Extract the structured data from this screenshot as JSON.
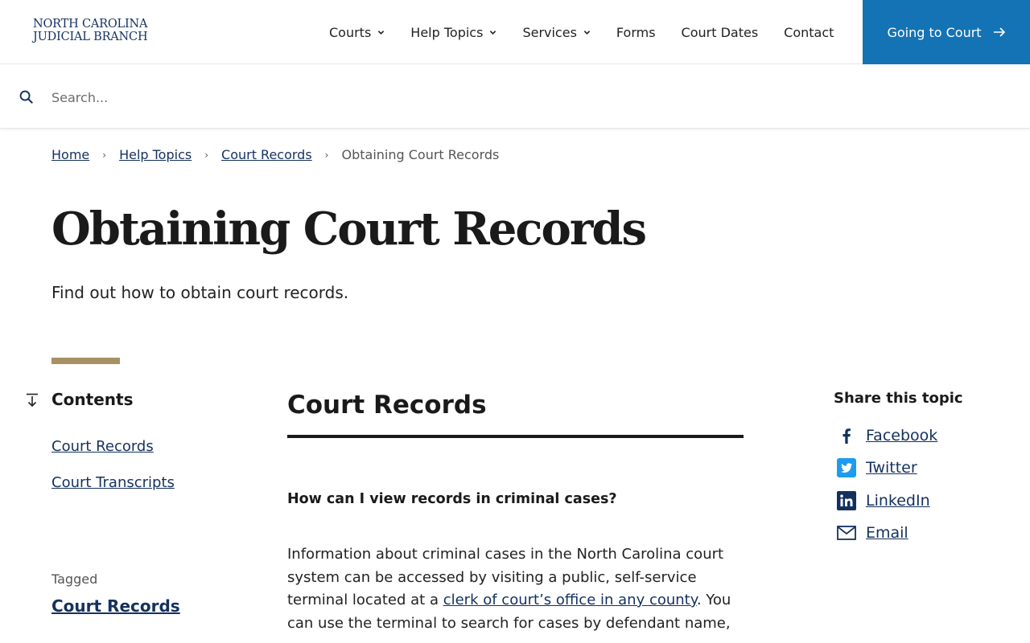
{
  "brand": {
    "line1": "NORTH CAROLINA",
    "line2": "JUDICIAL BRANCH",
    "color": "#14315e"
  },
  "nav": {
    "items": [
      {
        "label": "Courts",
        "dropdown": true
      },
      {
        "label": "Help Topics",
        "dropdown": true
      },
      {
        "label": "Services",
        "dropdown": true
      },
      {
        "label": "Forms",
        "dropdown": false
      },
      {
        "label": "Court Dates",
        "dropdown": false
      },
      {
        "label": "Contact",
        "dropdown": false
      }
    ],
    "cta_label": "Going to Court",
    "cta_color": "#1473b5"
  },
  "search": {
    "placeholder": "Search...",
    "icon": "search-icon"
  },
  "breadcrumb": {
    "home": "Home",
    "help_topics": "Help Topics",
    "court_records": "Court Records",
    "current": "Obtaining Court Records"
  },
  "page": {
    "title": "Obtaining Court Records",
    "subtitle": "Find out how to obtain court records."
  },
  "contents": {
    "title": "Contents",
    "links": [
      "Court Records",
      "Court Transcripts"
    ],
    "tagged_label": "Tagged",
    "tagged_link": "Court Records"
  },
  "main": {
    "section_heading": "Court Records",
    "question": "How can I view records in criminal cases?",
    "para_part1": "Information about criminal cases in the North Carolina court system can be accessed by visiting a public, self-service terminal located at a ",
    "para_link": "clerk of court’s office in any county",
    "para_part2": ". You can use the terminal to search for cases by defendant name,"
  },
  "share": {
    "title": "Share this topic",
    "items": [
      {
        "label": "Facebook",
        "icon": "facebook-icon"
      },
      {
        "label": "Twitter",
        "icon": "twitter-icon"
      },
      {
        "label": "LinkedIn",
        "icon": "linkedin-icon"
      },
      {
        "label": "Email",
        "icon": "email-icon"
      }
    ]
  },
  "colors": {
    "link": "#14315e",
    "accent_gold": "#a79064",
    "twitter": "#1d9bf0"
  }
}
